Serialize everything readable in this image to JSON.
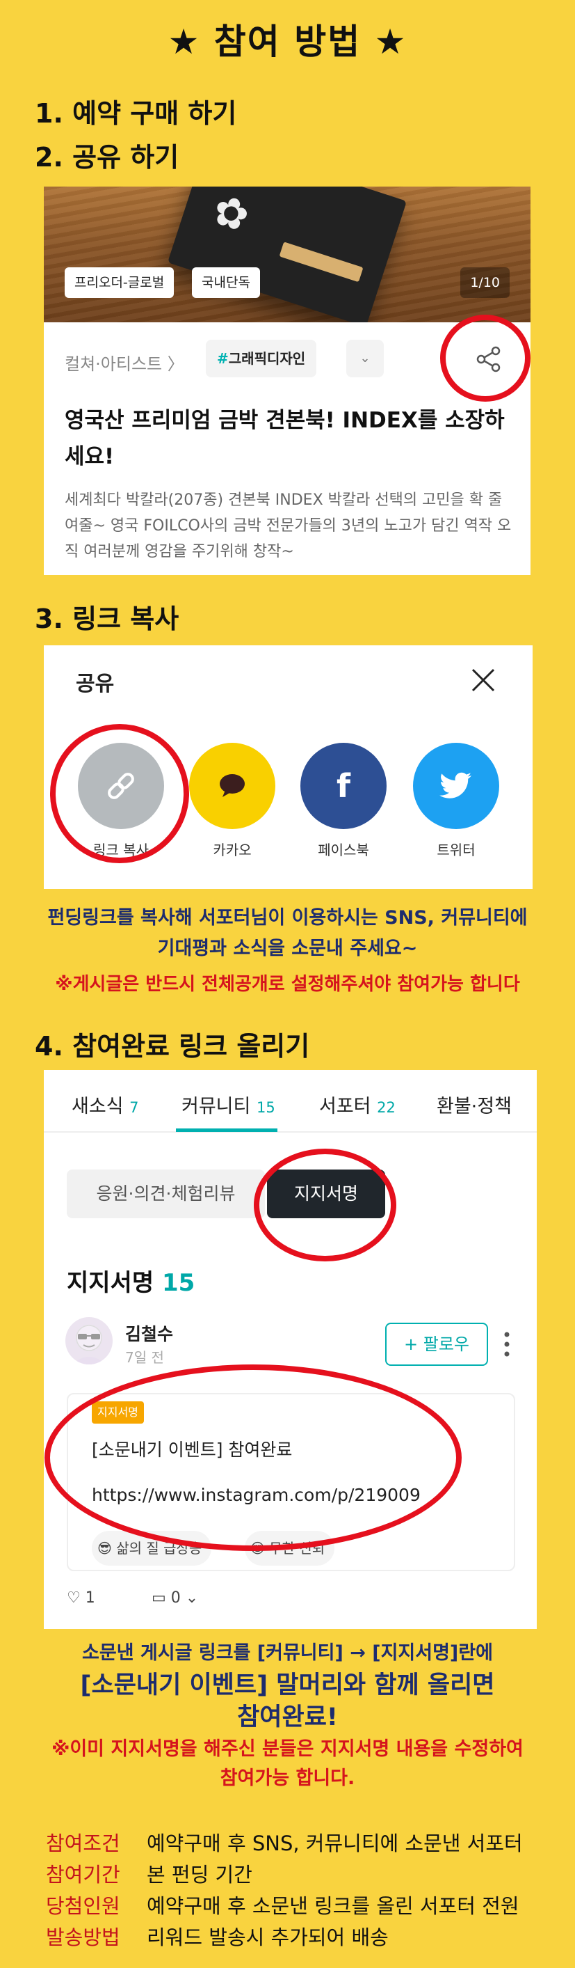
{
  "title": "★  참여 방법  ★",
  "steps": {
    "s1": "1. 예약 구매 하기",
    "s2": "2. 공유 하기",
    "s3": "3. 링크 복사",
    "s4": "4. 참여완료 링크 올리기"
  },
  "product": {
    "tags": [
      "프리오더-글로벌",
      "국내단독"
    ],
    "counter": "1/10",
    "category": "컬쳐·아티스트 〉",
    "hashtag_mark": "#",
    "hashtag": "그래픽디자인",
    "title": "영국산 프리미엄 금박 견본북! INDEX를 소장하세요!",
    "description": "세계최다 박칼라(207종) 견본북 INDEX 박칼라 선택의 고민을 확 줄여줄~ 영국 FOILCO사의 금박 전문가들의 3년의 노고가 담긴 역작 오직 여러분께 영감을 주기위해 창작~"
  },
  "share_dialog": {
    "title": "공유",
    "buttons": [
      {
        "label": "링크 복사",
        "icon": "link-icon",
        "color": "#b5babd"
      },
      {
        "label": "카카오",
        "icon": "kakao-icon",
        "color": "#f9d000"
      },
      {
        "label": "페이스북",
        "icon": "facebook-icon",
        "color": "#2d4f94"
      },
      {
        "label": "트위터",
        "icon": "twitter-icon",
        "color": "#1da1f2"
      }
    ]
  },
  "notice1": {
    "line1": "펀딩링크를 복사해 서포터님이 이용하시는 SNS, 커뮤니티에",
    "line2": "기대평과 소식을 소문내 주세요~",
    "warn": "※게시글은 반드시 전체공개로 설정해주셔야 참여가능 합니다"
  },
  "community": {
    "tabs": [
      {
        "label": "새소식",
        "count": "7"
      },
      {
        "label": "커뮤니티",
        "count": "15"
      },
      {
        "label": "서포터",
        "count": "22"
      },
      {
        "label": "환불·정책",
        "count": ""
      }
    ],
    "filter_left": "응원·의견·체험리뷰",
    "filter_right": "지지서명",
    "section_title": "지지서명",
    "section_count": "15",
    "user": "김철수",
    "time": "7일 전",
    "follow": "+ 팔로우",
    "badge": "지지서명",
    "post_title": "[소문내기 이벤트] 참여완료",
    "post_url": "https://www.instagram.com/p/219009",
    "reactions": [
      "삶의 질 급상승",
      "무한 신뢰"
    ],
    "likes": "♡ 1",
    "comments": "0"
  },
  "notice2": {
    "line1": "소문낸 게시글 링크를 [커뮤니티] → [지지서명]란에",
    "line2": "[소문내기 이벤트] 말머리와 함께 올리면",
    "line3": "참여완료!",
    "warn1": "※이미 지지서명을 해주신 분들은 지지서명 내용을 수정하여",
    "warn2": "참여가능 합니다."
  },
  "conditions": [
    {
      "key": "참여조건",
      "value": "예약구매 후 SNS, 커뮤니티에 소문낸 서포터"
    },
    {
      "key": "참여기간",
      "value": "본 펀딩 기간"
    },
    {
      "key": "당첨인원",
      "value": "예약구매 후 소문낸 링크를 올린 서포터 전원"
    },
    {
      "key": "발송방법",
      "value": "리워드 발송시 추가되어 배송"
    }
  ],
  "colors": {
    "background": "#f9d33f",
    "highlight_ring": "#e5101d",
    "accent": "#00b0b0",
    "navy_text": "#1d2c6e",
    "red_text": "#d5131d"
  }
}
